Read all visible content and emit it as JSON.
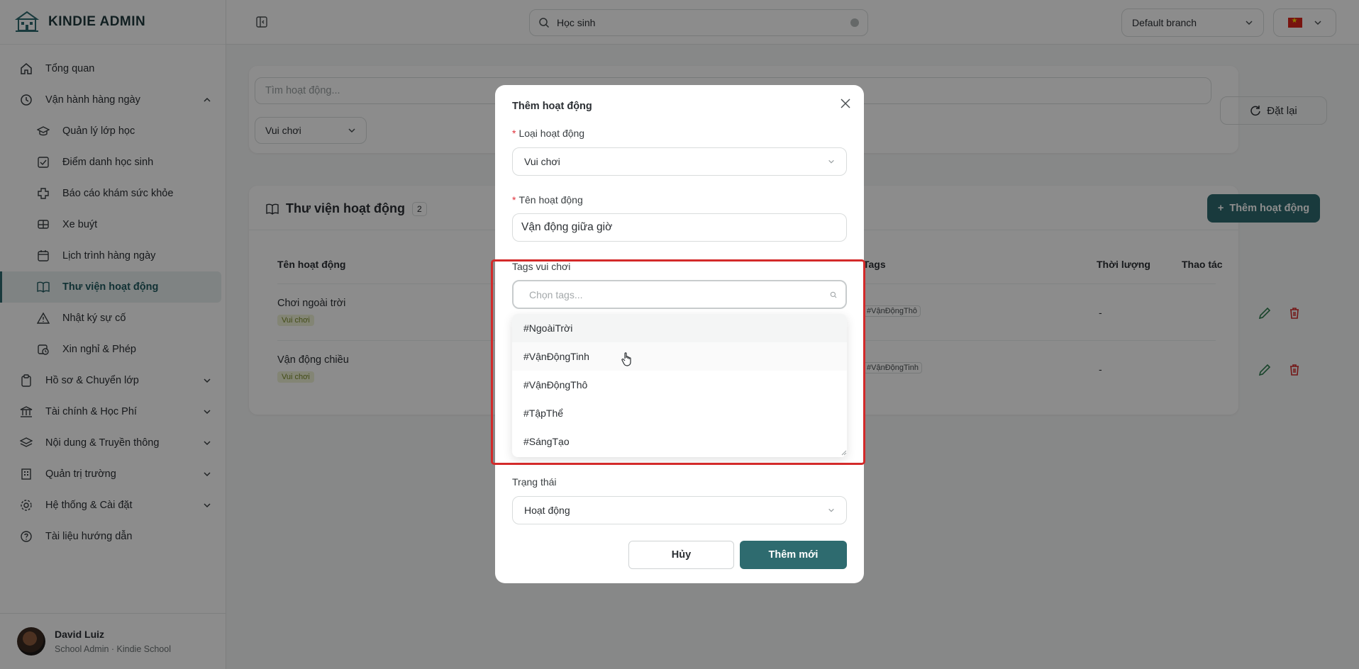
{
  "brand": {
    "name": "KINDIE ADMIN"
  },
  "sidebar": {
    "items": [
      {
        "label": "Tổng quan",
        "icon": "home-icon"
      },
      {
        "label": "Vận hành hàng ngày",
        "icon": "clock-icon",
        "expanded": true
      },
      {
        "label": "Hồ sơ & Chuyển lớp",
        "icon": "clipboard-icon"
      },
      {
        "label": "Tài chính & Học Phí",
        "icon": "bank-icon"
      },
      {
        "label": "Nội dung & Truyền thông",
        "icon": "layers-icon"
      },
      {
        "label": "Quản trị trường",
        "icon": "building-icon"
      },
      {
        "label": "Hệ thống & Cài đặt",
        "icon": "gear-icon"
      },
      {
        "label": "Tài liệu hướng dẫn",
        "icon": "help-icon"
      }
    ],
    "subitems": [
      {
        "label": "Quản lý lớp học",
        "icon": "graduation-cap-icon"
      },
      {
        "label": "Điểm danh học sinh",
        "icon": "checkbox-icon"
      },
      {
        "label": "Báo cáo khám sức khỏe",
        "icon": "medical-cross-icon"
      },
      {
        "label": "Xe buýt",
        "icon": "bus-icon"
      },
      {
        "label": "Lịch trình hàng ngày",
        "icon": "calendar-icon"
      },
      {
        "label": "Thư viện hoạt động",
        "icon": "book-icon",
        "active": true
      },
      {
        "label": "Nhật ký sự cố",
        "icon": "warning-icon"
      },
      {
        "label": "Xin nghỉ & Phép",
        "icon": "calendar-clock-icon"
      }
    ]
  },
  "user": {
    "name": "David Luiz",
    "role": "School Admin · Kindie School"
  },
  "topbar": {
    "search_value": "Học sinh",
    "branch": "Default branch"
  },
  "filters": {
    "search_placeholder": "Tìm hoạt động...",
    "type_value": "Vui chơi",
    "reset_label": "Đặt lại"
  },
  "library": {
    "title": "Thư viện hoạt động",
    "count": "2",
    "add_label": "Thêm hoạt động",
    "columns": {
      "name": "Tên hoạt động",
      "tags": "Tags",
      "duration": "Thời lượng",
      "actions": "Thao tác"
    },
    "rows": [
      {
        "name": "Chơi ngoài trời",
        "type": "Vui chơi",
        "tag": "#VậnĐộngThô",
        "duration": "-"
      },
      {
        "name": "Vận động chiều",
        "type": "Vui chơi",
        "tag": "#VậnĐộngTinh",
        "duration": "-"
      }
    ]
  },
  "modal": {
    "title": "Thêm hoạt động",
    "type_label": "Loại hoạt động",
    "type_value": "Vui chơi",
    "name_label": "Tên hoạt động",
    "name_value": "Vận động giữa giờ",
    "tags_label": "Tags vui chơi",
    "tags_placeholder": "Chọn tags...",
    "tag_options": [
      "#NgoàiTrời",
      "#VậnĐộngTinh",
      "#VậnĐộngThô",
      "#TậpThể",
      "#SángTạo"
    ],
    "status_label": "Trạng thái",
    "status_value": "Hoạt động",
    "cancel_label": "Hủy",
    "submit_label": "Thêm mới"
  },
  "colors": {
    "primary": "#2e6b6f",
    "highlight": "#d32a2a",
    "required": "#e0323b"
  }
}
